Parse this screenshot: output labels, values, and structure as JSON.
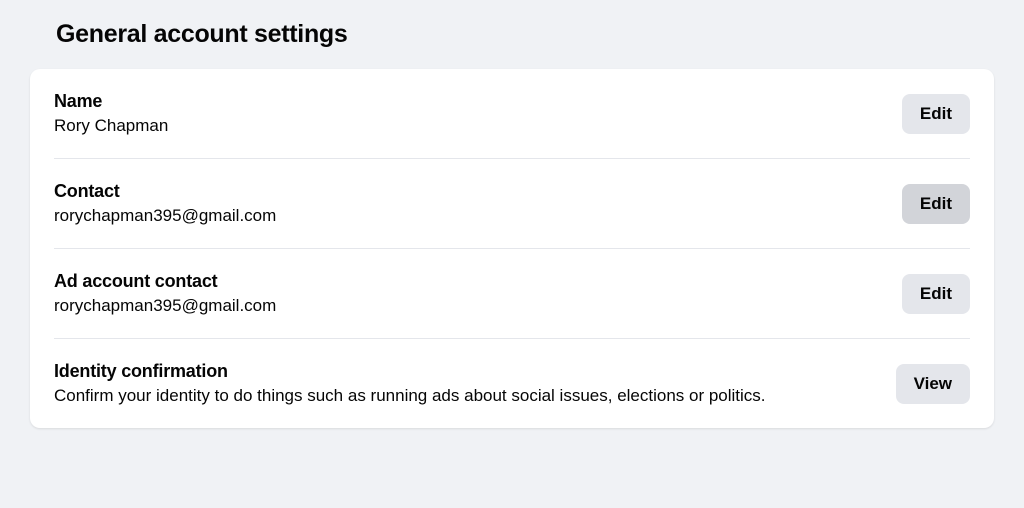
{
  "page": {
    "title": "General account settings"
  },
  "rows": {
    "name": {
      "label": "Name",
      "value": "Rory Chapman",
      "action": "Edit"
    },
    "contact": {
      "label": "Contact",
      "value": "rorychapman395@gmail.com",
      "action": "Edit"
    },
    "ad_contact": {
      "label": "Ad account contact",
      "value": "rorychapman395@gmail.com",
      "action": "Edit"
    },
    "identity": {
      "label": "Identity confirmation",
      "value": "Confirm your identity to do things such as running ads about social issues, elections or politics.",
      "action": "View"
    }
  }
}
